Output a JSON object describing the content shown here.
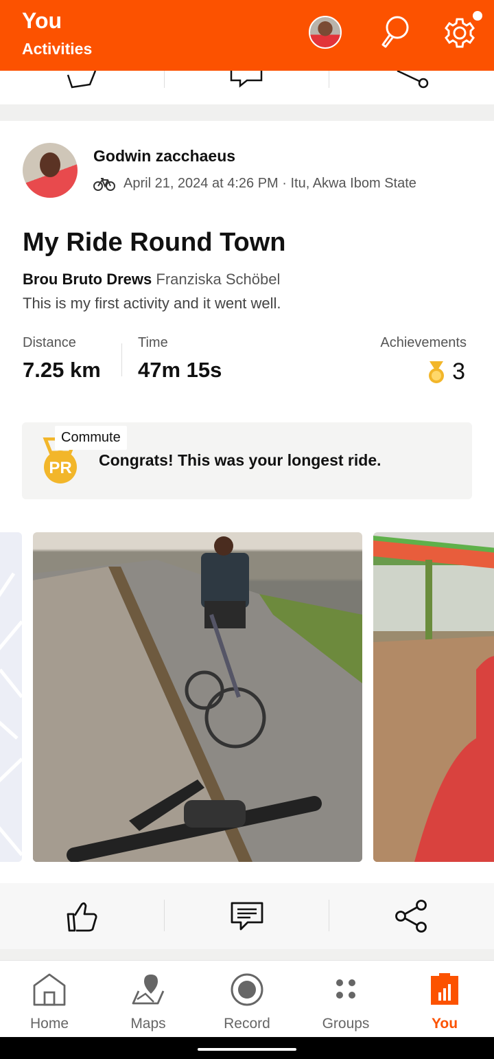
{
  "header": {
    "title": "You",
    "subtitle": "Activities",
    "accent_color": "#fc5200",
    "icons": [
      "avatar",
      "search-icon",
      "gear-icon"
    ]
  },
  "activity": {
    "user_name": "Godwin zacchaeus",
    "sport_icon": "bike-icon",
    "datetime_location": "April 21, 2024 at 4:26 PM · Itu, Akwa Ibom State",
    "title": "My Ride Round Town",
    "gear_bold": "Brou Bruto Drews",
    "gear_model": "Franziska Schöbel",
    "description": "This is my first activity and it went well.",
    "stats": {
      "distance_label": "Distance",
      "distance_value": "7.25 km",
      "time_label": "Time",
      "time_value": "47m 15s",
      "achievements_label": "Achievements",
      "achievements_value": "3"
    },
    "congrats": {
      "badge_text": "PR",
      "message": "Congrats! This was your longest ride."
    },
    "photo_tag": "Commute"
  },
  "actions": [
    "like-icon",
    "comment-icon",
    "share-icon"
  ],
  "bottom_nav": {
    "items": [
      {
        "label": "Home",
        "icon": "home-icon"
      },
      {
        "label": "Maps",
        "icon": "maps-icon"
      },
      {
        "label": "Record",
        "icon": "record-icon"
      },
      {
        "label": "Groups",
        "icon": "groups-icon"
      },
      {
        "label": "You",
        "icon": "you-icon",
        "active": true
      }
    ]
  }
}
